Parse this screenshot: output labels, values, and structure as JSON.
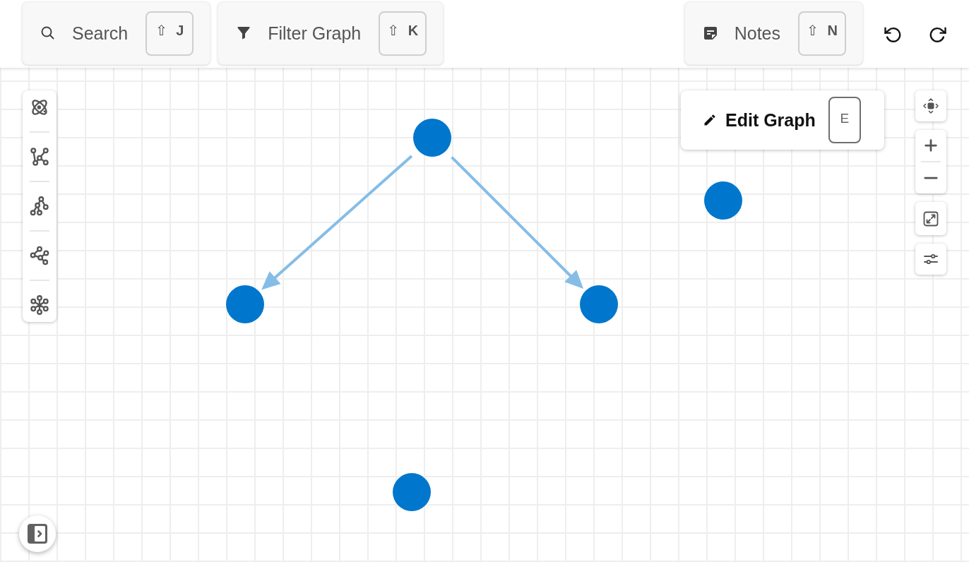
{
  "toolbar": {
    "search": {
      "label": "Search",
      "shortcut": "⇧ **J**"
    },
    "filter": {
      "label": "Filter Graph",
      "shortcut": "⇧ **K**"
    },
    "notes": {
      "label": "Notes",
      "shortcut": "⇧ **N**"
    }
  },
  "edit_panel": {
    "label": "Edit Graph",
    "shortcut": "E"
  }
}
